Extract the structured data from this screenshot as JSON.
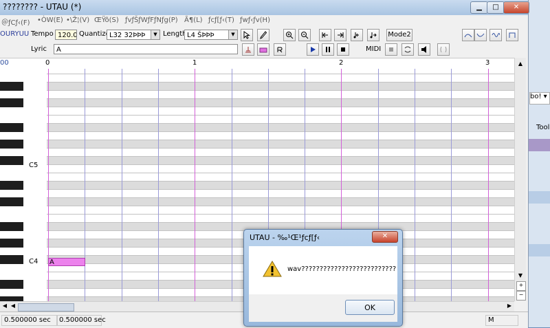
{
  "window": {
    "title": "???????? - UTAU (*)",
    "controls": {
      "minimize": "▁",
      "maximize": "□",
      "close": "✕"
    }
  },
  "menu": [
    "＠ƒCƒ‹(F)",
    "•ÒW(E)",
    "•\\Ž¦(V)",
    "ŒŸõ(S)",
    "ƒvƒŠƒWƒFƒNƒg(P)",
    "Ã¶(L)",
    "ƒcƒ[ƒ‹(T)",
    "ƒwƒ‹ƒv(H)"
  ],
  "toolbar": {
    "project_name": "OURYUU",
    "tempo_label": "Tempo",
    "tempo_value": "120.0",
    "quantize_label": "Quantize",
    "quantize_value": "L32 32ÞÞÞ",
    "length_label": "Length",
    "length_value": "L4 ŠÞÞÞ",
    "mode2": "Mode2",
    "lyric_label": "Lyric",
    "lyric_value": "A",
    "midi_label": "MIDI",
    "icons": [
      "pointer-tool",
      "pencil-tool",
      "zoom-in",
      "zoom-out",
      "go-start",
      "go-end",
      "shrink",
      "stretch",
      "play",
      "pause",
      "stop"
    ]
  },
  "ruler": {
    "left": "00",
    "measures": [
      "0",
      "1",
      "2",
      "3"
    ]
  },
  "piano": {
    "labels": [
      "C5",
      "C4"
    ]
  },
  "note": {
    "lyric": "A"
  },
  "status": {
    "left": "0.500000 sec",
    "mid": "0.500000 sec",
    "mode": "M"
  },
  "right_strip": {
    "item1": "bo!",
    "item2": "Tool"
  },
  "dialog": {
    "title": "UTAU - ‰¹Œ¹ƒcƒ[ƒ‹",
    "message": "wav??????????????????????????",
    "ok": "OK",
    "close": "✕"
  },
  "colors": {
    "measure_line": "#d25fd8",
    "beat_line": "#9a9ad8",
    "note_fill": "#ec82ec",
    "row_shade": "#dcdcdc"
  }
}
